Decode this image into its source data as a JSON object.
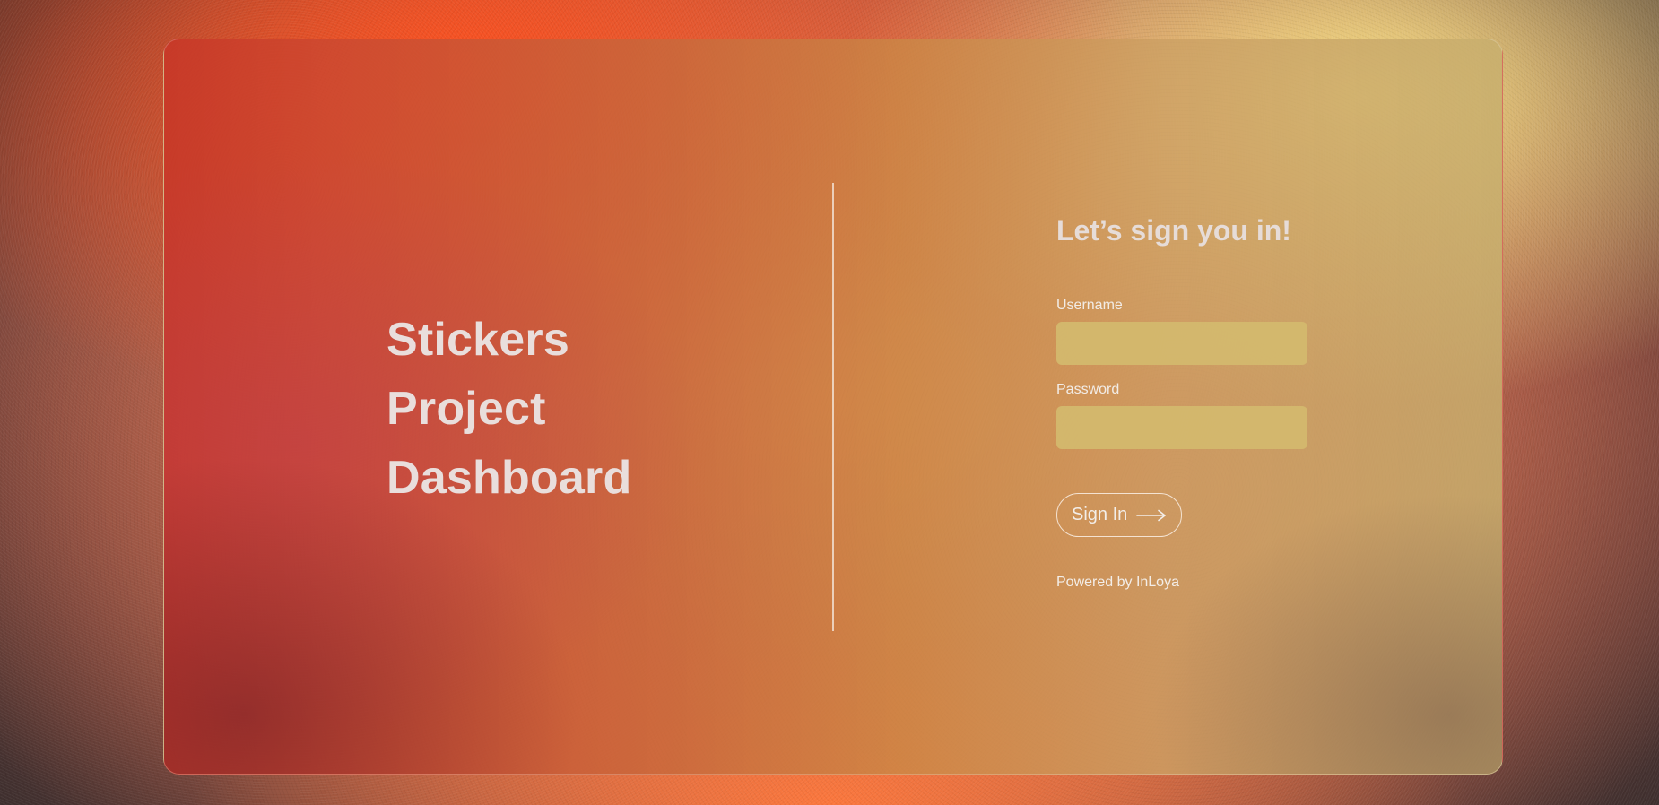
{
  "brand": {
    "title_lines": [
      "Stickers",
      "Project",
      "Dashboard"
    ]
  },
  "form": {
    "heading": "Let’s sign you in!",
    "username_label": "Username",
    "username_value": "",
    "password_label": "Password",
    "password_value": "",
    "submit_label": "Sign In",
    "submit_icon": "arrow-right-icon"
  },
  "footer": {
    "powered_by": "Powered by InLoya"
  },
  "colors": {
    "text_light": "#e9dedc",
    "input_fill": "#d4ba6e",
    "card_left": "#c83828",
    "card_right": "#c8af6e"
  }
}
